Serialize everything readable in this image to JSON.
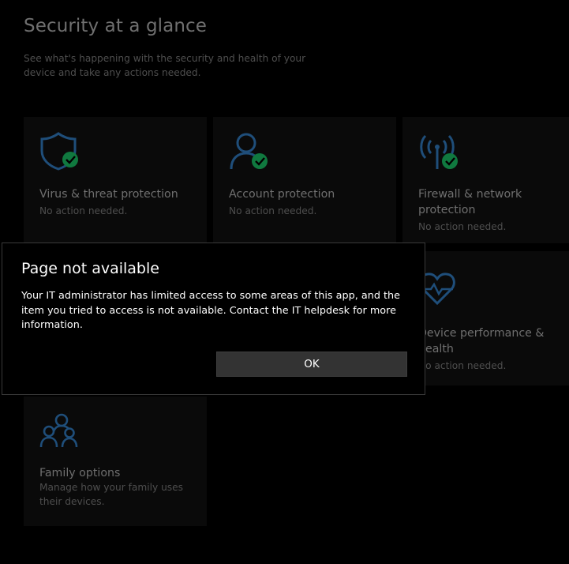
{
  "header": {
    "title": "Security at a glance",
    "subtitle": "See what's happening with the security and health of your device and take any actions needed."
  },
  "tiles": [
    {
      "title": "Virus & threat protection",
      "status": "No action needed.",
      "icon": "shield-check-icon"
    },
    {
      "title": "Account protection",
      "status": "No action needed.",
      "icon": "person-check-icon"
    },
    {
      "title": "Firewall & network protection",
      "status": "No action needed.",
      "icon": "wifi-antenna-check-icon"
    },
    {
      "title": "Device performance & health",
      "status": "No action needed.",
      "icon": "heart-pulse-icon"
    },
    {
      "title": "Family options",
      "status": "Manage how your family uses their devices.",
      "icon": "family-icon"
    }
  ],
  "dialog": {
    "title": "Page not available",
    "message": "Your IT administrator has limited access to some areas of this app, and the item you tried to access is not available. Contact the IT helpdesk for more information.",
    "ok_label": "OK"
  },
  "colors": {
    "icon_blue": "#1f4e7a",
    "check_green": "#10793f",
    "dim_text": "#6f6f6f",
    "dimmer_text": "#4e4e4e",
    "dialog_border": "#3a3a3a",
    "button_bg": "#333333"
  }
}
